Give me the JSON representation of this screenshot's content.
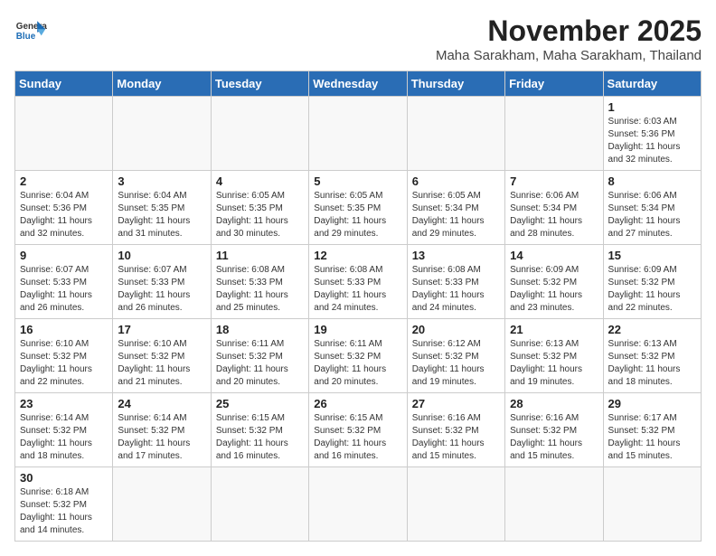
{
  "header": {
    "logo_general": "General",
    "logo_blue": "Blue",
    "month_title": "November 2025",
    "location": "Maha Sarakham, Maha Sarakham, Thailand"
  },
  "days_of_week": [
    "Sunday",
    "Monday",
    "Tuesday",
    "Wednesday",
    "Thursday",
    "Friday",
    "Saturday"
  ],
  "weeks": [
    [
      {
        "day": "",
        "info": ""
      },
      {
        "day": "",
        "info": ""
      },
      {
        "day": "",
        "info": ""
      },
      {
        "day": "",
        "info": ""
      },
      {
        "day": "",
        "info": ""
      },
      {
        "day": "",
        "info": ""
      },
      {
        "day": "1",
        "info": "Sunrise: 6:03 AM\nSunset: 5:36 PM\nDaylight: 11 hours\nand 32 minutes."
      }
    ],
    [
      {
        "day": "2",
        "info": "Sunrise: 6:04 AM\nSunset: 5:36 PM\nDaylight: 11 hours\nand 32 minutes."
      },
      {
        "day": "3",
        "info": "Sunrise: 6:04 AM\nSunset: 5:35 PM\nDaylight: 11 hours\nand 31 minutes."
      },
      {
        "day": "4",
        "info": "Sunrise: 6:05 AM\nSunset: 5:35 PM\nDaylight: 11 hours\nand 30 minutes."
      },
      {
        "day": "5",
        "info": "Sunrise: 6:05 AM\nSunset: 5:35 PM\nDaylight: 11 hours\nand 29 minutes."
      },
      {
        "day": "6",
        "info": "Sunrise: 6:05 AM\nSunset: 5:34 PM\nDaylight: 11 hours\nand 29 minutes."
      },
      {
        "day": "7",
        "info": "Sunrise: 6:06 AM\nSunset: 5:34 PM\nDaylight: 11 hours\nand 28 minutes."
      },
      {
        "day": "8",
        "info": "Sunrise: 6:06 AM\nSunset: 5:34 PM\nDaylight: 11 hours\nand 27 minutes."
      }
    ],
    [
      {
        "day": "9",
        "info": "Sunrise: 6:07 AM\nSunset: 5:33 PM\nDaylight: 11 hours\nand 26 minutes."
      },
      {
        "day": "10",
        "info": "Sunrise: 6:07 AM\nSunset: 5:33 PM\nDaylight: 11 hours\nand 26 minutes."
      },
      {
        "day": "11",
        "info": "Sunrise: 6:08 AM\nSunset: 5:33 PM\nDaylight: 11 hours\nand 25 minutes."
      },
      {
        "day": "12",
        "info": "Sunrise: 6:08 AM\nSunset: 5:33 PM\nDaylight: 11 hours\nand 24 minutes."
      },
      {
        "day": "13",
        "info": "Sunrise: 6:08 AM\nSunset: 5:33 PM\nDaylight: 11 hours\nand 24 minutes."
      },
      {
        "day": "14",
        "info": "Sunrise: 6:09 AM\nSunset: 5:32 PM\nDaylight: 11 hours\nand 23 minutes."
      },
      {
        "day": "15",
        "info": "Sunrise: 6:09 AM\nSunset: 5:32 PM\nDaylight: 11 hours\nand 22 minutes."
      }
    ],
    [
      {
        "day": "16",
        "info": "Sunrise: 6:10 AM\nSunset: 5:32 PM\nDaylight: 11 hours\nand 22 minutes."
      },
      {
        "day": "17",
        "info": "Sunrise: 6:10 AM\nSunset: 5:32 PM\nDaylight: 11 hours\nand 21 minutes."
      },
      {
        "day": "18",
        "info": "Sunrise: 6:11 AM\nSunset: 5:32 PM\nDaylight: 11 hours\nand 20 minutes."
      },
      {
        "day": "19",
        "info": "Sunrise: 6:11 AM\nSunset: 5:32 PM\nDaylight: 11 hours\nand 20 minutes."
      },
      {
        "day": "20",
        "info": "Sunrise: 6:12 AM\nSunset: 5:32 PM\nDaylight: 11 hours\nand 19 minutes."
      },
      {
        "day": "21",
        "info": "Sunrise: 6:13 AM\nSunset: 5:32 PM\nDaylight: 11 hours\nand 19 minutes."
      },
      {
        "day": "22",
        "info": "Sunrise: 6:13 AM\nSunset: 5:32 PM\nDaylight: 11 hours\nand 18 minutes."
      }
    ],
    [
      {
        "day": "23",
        "info": "Sunrise: 6:14 AM\nSunset: 5:32 PM\nDaylight: 11 hours\nand 18 minutes."
      },
      {
        "day": "24",
        "info": "Sunrise: 6:14 AM\nSunset: 5:32 PM\nDaylight: 11 hours\nand 17 minutes."
      },
      {
        "day": "25",
        "info": "Sunrise: 6:15 AM\nSunset: 5:32 PM\nDaylight: 11 hours\nand 16 minutes."
      },
      {
        "day": "26",
        "info": "Sunrise: 6:15 AM\nSunset: 5:32 PM\nDaylight: 11 hours\nand 16 minutes."
      },
      {
        "day": "27",
        "info": "Sunrise: 6:16 AM\nSunset: 5:32 PM\nDaylight: 11 hours\nand 15 minutes."
      },
      {
        "day": "28",
        "info": "Sunrise: 6:16 AM\nSunset: 5:32 PM\nDaylight: 11 hours\nand 15 minutes."
      },
      {
        "day": "29",
        "info": "Sunrise: 6:17 AM\nSunset: 5:32 PM\nDaylight: 11 hours\nand 15 minutes."
      }
    ],
    [
      {
        "day": "30",
        "info": "Sunrise: 6:18 AM\nSunset: 5:32 PM\nDaylight: 11 hours\nand 14 minutes."
      },
      {
        "day": "",
        "info": ""
      },
      {
        "day": "",
        "info": ""
      },
      {
        "day": "",
        "info": ""
      },
      {
        "day": "",
        "info": ""
      },
      {
        "day": "",
        "info": ""
      },
      {
        "day": "",
        "info": ""
      }
    ]
  ]
}
